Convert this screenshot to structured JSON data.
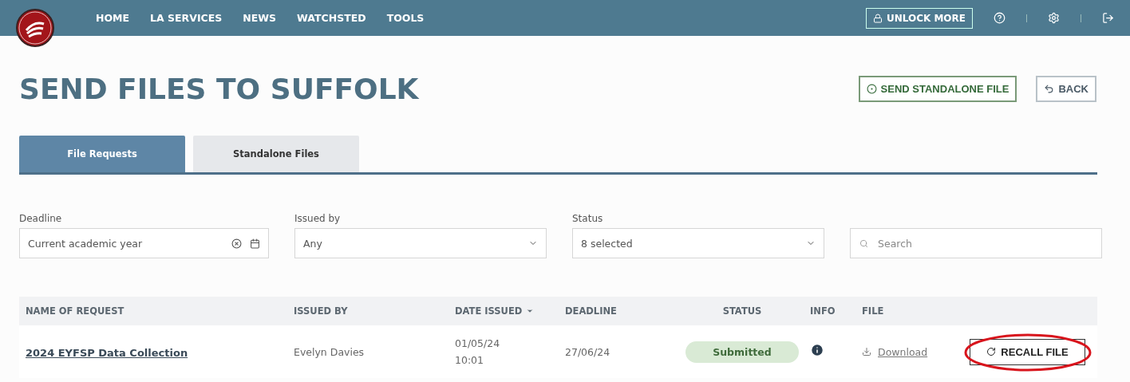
{
  "nav": {
    "items": [
      {
        "label": "HOME"
      },
      {
        "label": "LA SERVICES"
      },
      {
        "label": "NEWS"
      },
      {
        "label": "WATCHSTED"
      },
      {
        "label": "TOOLS"
      }
    ],
    "unlock": "UNLOCK MORE"
  },
  "page": {
    "title": "SEND FILES TO SUFFOLK",
    "actions": [
      {
        "kind": "primary",
        "label": "SEND STANDALONE FILE"
      },
      {
        "kind": "back",
        "label": "BACK"
      }
    ]
  },
  "tabs": [
    {
      "label": "File Requests",
      "selected": true
    },
    {
      "label": "Standalone Files",
      "selected": false
    }
  ],
  "filters": [
    {
      "kind": "date",
      "label": "Deadline",
      "value": "Current academic year"
    },
    {
      "kind": "select",
      "label": "Issued by",
      "value": "Any"
    },
    {
      "kind": "select",
      "label": "Status",
      "value": "8 selected"
    },
    {
      "kind": "search",
      "placeholder": "Search"
    }
  ],
  "table": {
    "columns": [
      {
        "label": "NAME OF REQUEST",
        "sorted": false
      },
      {
        "label": "ISSUED BY",
        "sorted": false
      },
      {
        "label": "DATE ISSUED",
        "sorted": true
      },
      {
        "label": "DEADLINE",
        "sorted": false
      },
      {
        "label": "STATUS",
        "sorted": false
      },
      {
        "label": "INFO",
        "sorted": false
      },
      {
        "label": "FILE",
        "sorted": false
      }
    ],
    "rows": [
      {
        "name": "2024 EYFSP Data Collection",
        "issued_by": "Evelyn Davies",
        "date": "01/05/24",
        "time": "10:01",
        "deadline": "27/06/24",
        "status": "Submitted",
        "file": "Download",
        "action": "RECALL FILE",
        "highlighted": true
      }
    ]
  }
}
